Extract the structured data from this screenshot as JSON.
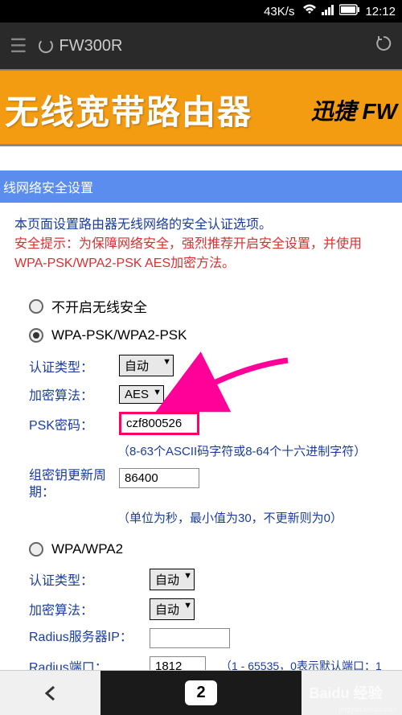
{
  "statusBar": {
    "speed": "43K/s",
    "time": "12:12"
  },
  "browserBar": {
    "url": "FW300R"
  },
  "banner": {
    "title": "无线宽带路由器",
    "brand": "迅捷 FW"
  },
  "section": {
    "header": "线网络安全设置"
  },
  "description": {
    "intro": "本页面设置路由器无线网络的安全认证选项。",
    "warning": "安全提示：为保障网络安全，强烈推荐开启安全设置，并使用WPA-PSK/WPA2-PSK AES加密方法。"
  },
  "options": {
    "noSecurity": {
      "label": "不开启无线安全"
    },
    "wpaPsk": {
      "label": "WPA-PSK/WPA2-PSK",
      "authType": {
        "label": "认证类型：",
        "value": "自动"
      },
      "encAlg": {
        "label": "加密算法：",
        "value": "AES"
      },
      "pskPass": {
        "label": "PSK密码：",
        "value": "czf800526",
        "hint": "（8-63个ASCII码字符或8-64个十六进制字符）"
      },
      "groupKey": {
        "label": "组密钥更新周期：",
        "value": "86400",
        "hint": "（单位为秒，最小值为30，不更新则为0）"
      }
    },
    "wpa": {
      "label": "WPA/WPA2",
      "authType": {
        "label": "认证类型：",
        "value": "自动"
      },
      "encAlg": {
        "label": "加密算法：",
        "value": "自动"
      },
      "radiusIp": {
        "label": "Radius服务器IP：",
        "value": ""
      },
      "radiusPort": {
        "label": "Radius端口：",
        "value": "1812",
        "hint": "（1 - 65535，0表示默认端口：1"
      }
    }
  },
  "bottomBar": {
    "tabCount": "2"
  },
  "watermark": {
    "main": "Baidu 经验",
    "url": "jingyan.baidu.com"
  }
}
